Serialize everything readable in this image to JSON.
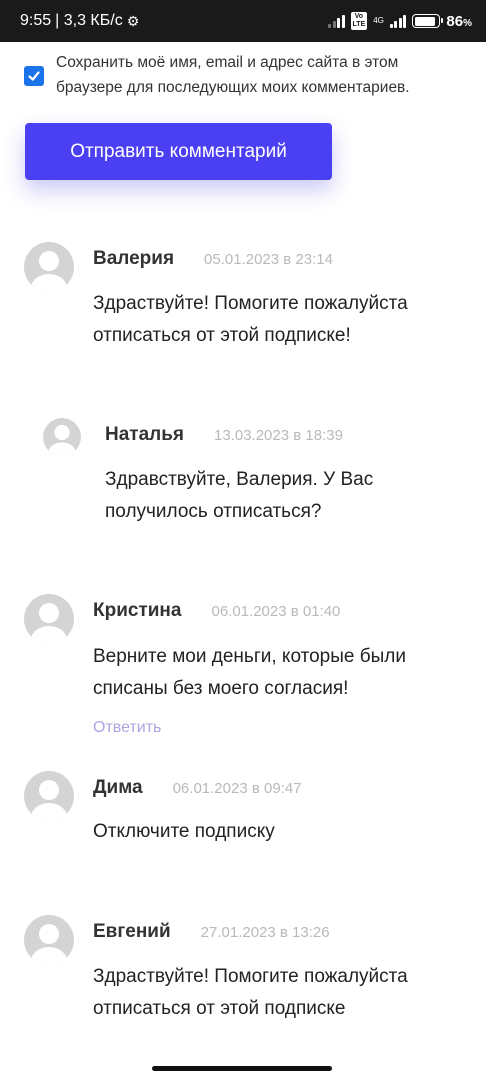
{
  "status_bar": {
    "time": "9:55",
    "network_speed": "| 3,3 КБ/с",
    "settings_icon": "gear-icon",
    "volte_label": "Vo LTE",
    "network_type": "4G",
    "battery_percent": "86",
    "battery_unit": "%",
    "battery_level": 0.86
  },
  "form": {
    "save_consent_text": "Сохранить моё имя, email и адрес сайта в этом браузере для последующих моих комментариев.",
    "save_consent_checked": true,
    "submit_label": "Отправить комментарий"
  },
  "comments": [
    {
      "author": "Валерия",
      "date": "05.01.2023 в 23:14",
      "text": "Здраствуйте! Помогите пожалуйста отписаться от этой подписке!",
      "reply_label": ""
    },
    {
      "author": "Наталья",
      "date": "13.03.2023 в 18:39",
      "text": "Здравствуйте, Валерия. У Вас получилось отписаться?",
      "reply_label": ""
    },
    {
      "author": "Кристина",
      "date": "06.01.2023 в 01:40",
      "text": "Верните мои деньги, которые были списаны без моего согласия!",
      "reply_label": "Ответить"
    },
    {
      "author": "Дима",
      "date": "06.01.2023 в 09:47",
      "text": "Отключите подписку",
      "reply_label": ""
    },
    {
      "author": "Евгений",
      "date": "27.01.2023 в 13:26",
      "text": "Здраствуйте! Помогите пожалуйста отписаться от этой подписке",
      "reply_label": ""
    }
  ],
  "colors": {
    "accent": "#4a3ff2",
    "checkbox": "#1a73e8",
    "date": "#b9b9b9",
    "reply_link": "#a9a6e0"
  }
}
